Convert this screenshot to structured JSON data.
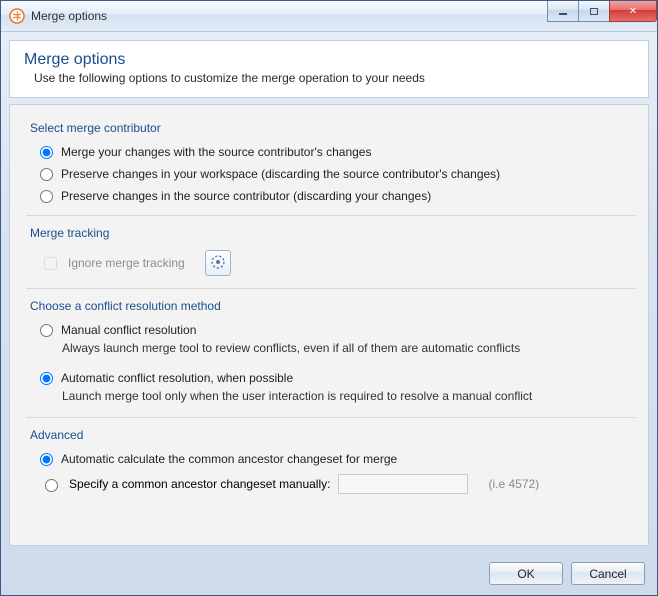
{
  "window": {
    "title": "Merge options"
  },
  "header": {
    "title": "Merge options",
    "subtitle": "Use the following options to customize the merge operation to your needs"
  },
  "groups": {
    "contributor": {
      "title": "Select merge contributor",
      "opt_merge": "Merge your changes with the source contributor's changes",
      "opt_preserve_workspace": "Preserve changes in your workspace (discarding the source contributor's changes)",
      "opt_preserve_source": "Preserve changes in the source contributor (discarding your changes)",
      "selected": "merge"
    },
    "tracking": {
      "title": "Merge tracking",
      "ignore_label": "Ignore merge tracking",
      "ignore_checked": false,
      "ignore_enabled": false
    },
    "conflict": {
      "title": "Choose a conflict resolution method",
      "manual_label": "Manual conflict resolution",
      "manual_desc": "Always launch merge tool to review conflicts, even if all of them are automatic conflicts",
      "auto_label": "Automatic conflict resolution, when possible",
      "auto_desc": "Launch merge tool only when the user interaction is required to resolve a manual conflict",
      "selected": "auto"
    },
    "advanced": {
      "title": "Advanced",
      "auto_ancestor": "Automatic calculate the common ancestor changeset for merge",
      "manual_ancestor": "Specify a common ancestor changeset manually:",
      "hint": "(i.e 4572)",
      "input_value": "",
      "selected": "auto"
    }
  },
  "footer": {
    "ok": "OK",
    "cancel": "Cancel"
  }
}
